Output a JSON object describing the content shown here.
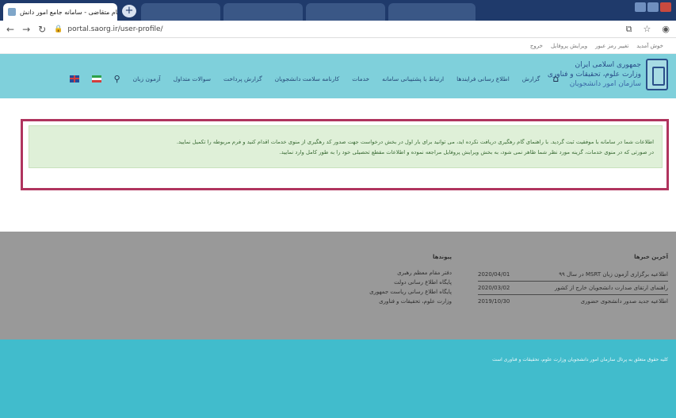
{
  "browser": {
    "active_tab_title": "ثبت نام متقاضی - سامانه جامع امور دانش...",
    "inactive_tabs": [
      "",
      "",
      "",
      ""
    ],
    "url": "portal.saorg.ir/user-profile/"
  },
  "topstrip": {
    "left_text": "",
    "links": [
      "خوش آمدید",
      "تغییر رمز عبور",
      "ویرایش پروفایل",
      "خروج"
    ]
  },
  "header": {
    "org_lines": [
      "جمهوری اسلامی ایران",
      "وزارت علوم، تحقیقات و فناوری",
      "سازمان امور دانشجویان"
    ],
    "menu": [
      "گزارش",
      "اطلاع رسانی فرایندها",
      "ارتباط با پشتیبانی سامانه",
      "خدمات",
      "کارنامه سلامت دانشجویان",
      "گزارش پرداخت",
      "سوالات متداول",
      "آزمون زبان"
    ]
  },
  "alert": {
    "line1": "اطلاعات شما در سامانه با موفقیت ثبت گردید. با راهنمای گام رهگیری دریافت نکرده اید، می توانید برای بار اول در بخش درخواست جهت صدور کد رهگیری از منوی خدمات اقدام کنید و فرم مربوطه را تکمیل نمایید.",
    "line2": "در صورتی که در منوی خدمات، گزینه مورد نظر شما ظاهر نمی شود، به بخش ویرایش پروفایل مراجعه نموده و اطلاعات مقطع تحصیلی خود را به طور کامل وارد نمایید."
  },
  "footer": {
    "news_heading": "آخرین خبرها",
    "news": [
      {
        "title": "اطلاعیه برگزاری آزمون زبان MSRT در سال ۹۹",
        "date": "2020/04/01"
      },
      {
        "title": "راهنمای ارتقای صدارت دانشجویان خارج از کشور",
        "date": "2020/03/02"
      },
      {
        "title": "اطلاعیه جدید صدور دانشجوی حضوری",
        "date": "2019/10/30"
      }
    ],
    "links_heading": "پیوندها",
    "links": [
      "دفتر مقام معظم رهبری",
      "پایگاه اطلاع رسانی دولت",
      "پایگاه اطلاع رسانی ریاست جمهوری",
      "وزارت علوم، تحقیقات و فناوری"
    ]
  },
  "bottom": {
    "copyright": "کلیه حقوق متعلق به پرتال سازمان امور دانشجویان وزارت علوم، تحقیقات و فناوری است"
  }
}
